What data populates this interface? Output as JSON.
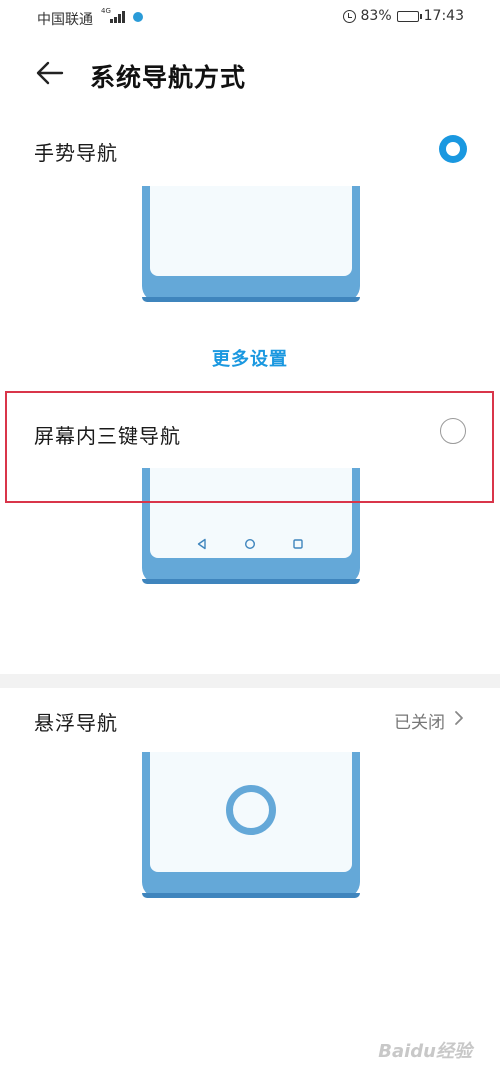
{
  "status_bar": {
    "carrier": "中国联通",
    "network": "4G",
    "battery": "83%",
    "time": "17:43"
  },
  "header": {
    "title": "系统导航方式"
  },
  "options": {
    "gesture": {
      "label": "手势导航",
      "selected": true
    },
    "more_settings": "更多设置",
    "three_key": {
      "label": "屏幕内三键导航",
      "selected": false
    },
    "floating": {
      "label": "悬浮导航",
      "status": "已关闭"
    }
  },
  "watermark": "Baidu经验",
  "colors": {
    "accent": "#1a98e0",
    "phone_illustration": "#64a8d8",
    "highlight_border": "#d9354a"
  }
}
